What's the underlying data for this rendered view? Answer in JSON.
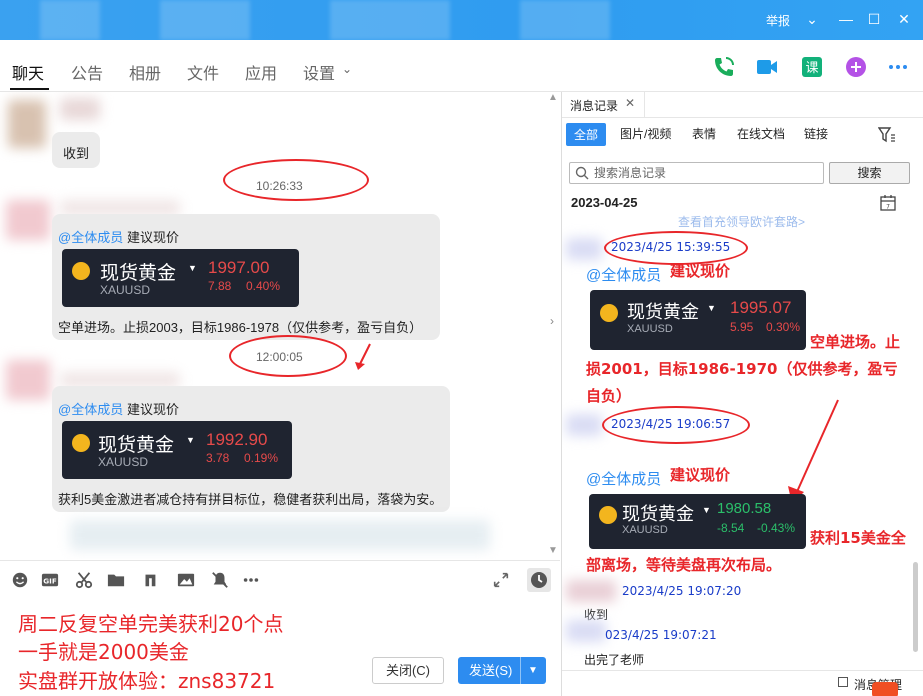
{
  "titlebar": {
    "report": "举报"
  },
  "tabs": [
    "聊天",
    "公告",
    "相册",
    "文件",
    "应用",
    "设置"
  ],
  "chat": {
    "msg1_text": "收到",
    "time1": "10:26:33",
    "mention": "@全体成员",
    "suggest": "建议现价",
    "card1": {
      "title": "现货黄金",
      "symbol": "XAUUSD",
      "price": "1997.00",
      "chg": "7.88",
      "pct": "0.40%"
    },
    "msg2_text": "空单进场。止损2003，目标1986-1978（仅供参考，盈亏自负）",
    "time2": "12:00:05",
    "card2": {
      "title": "现货黄金",
      "symbol": "XAUUSD",
      "price": "1992.90",
      "chg": "3.78",
      "pct": "0.19%"
    },
    "msg3_text": "获利5美金激进者减仓持有拼目标位，稳健者获利出局，落袋为安。"
  },
  "input": {
    "line1": "周二反复空单完美获利20个点",
    "line2": "一手就是2000美金",
    "line3": "实盘群开放体验：zns83721",
    "close_label": "关闭(C)",
    "send_label": "发送(S)"
  },
  "history": {
    "tab_label": "消息记录",
    "subtabs": [
      "全部",
      "图片/视频",
      "表情",
      "在线文档",
      "链接"
    ],
    "search_placeholder": "搜索消息记录",
    "search_btn": "搜索",
    "date": "2023-04-25",
    "faded_link": "查看首充领导欧许套路>",
    "t1": "2023/4/25 15:39:55",
    "mention": "@全体成员",
    "suggest": "建议现价",
    "card1": {
      "title": "现货黄金",
      "symbol": "XAUUSD",
      "price": "1995.07",
      "chg": "5.95",
      "pct": "0.30%"
    },
    "red1_a": "空单进场。止",
    "red1_b": "损2001，目标1986-1970（仅供参考，盈亏",
    "red1_c": "自负）",
    "t2": "2023/4/25 19:06:57",
    "card2": {
      "title": "现货黄金",
      "symbol": "XAUUSD",
      "price": "1980.58",
      "chg": "-8.54",
      "pct": "-0.43%"
    },
    "red2_a": "获利15美金全",
    "red2_b": "部离场，等待美盘再次布局。",
    "t3": "2023/4/25 19:07:20",
    "msg3": "收到",
    "t4": "023/4/25 19:07:21",
    "msg4": "出完了老师",
    "footer": "消息管理"
  },
  "colors": {
    "accent": "#2d8cf0",
    "red": "#e8262a",
    "up": "#e64a4a",
    "down": "#2bbf6a"
  }
}
